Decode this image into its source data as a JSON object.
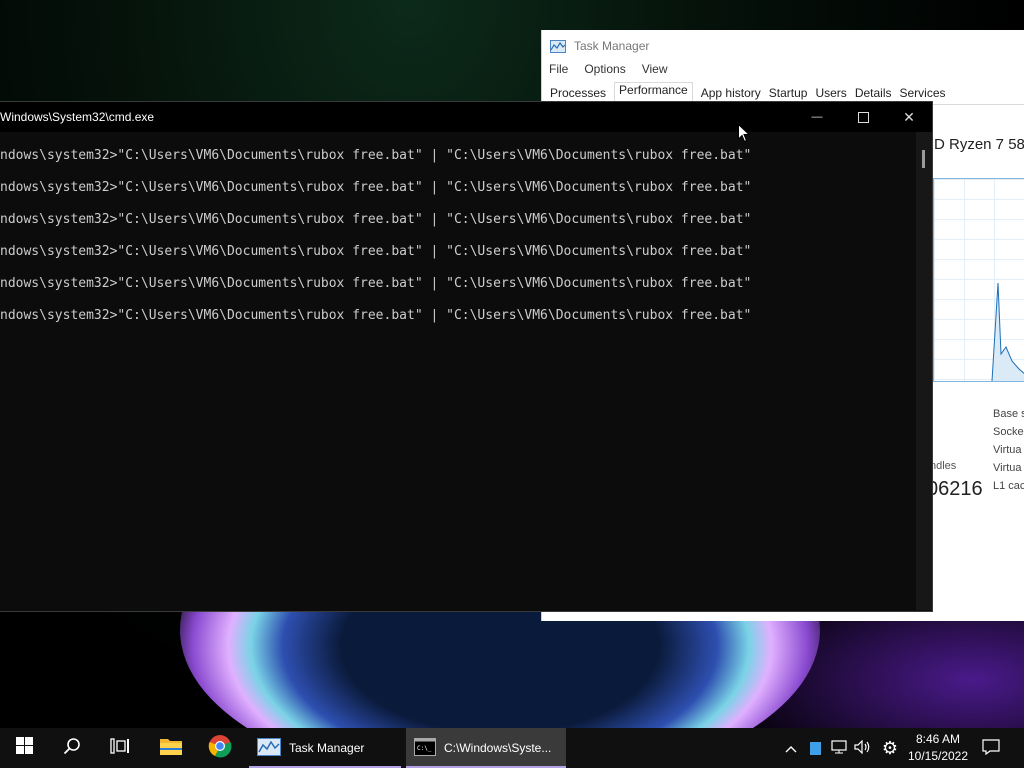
{
  "task_manager": {
    "title": "Task Manager",
    "menu": [
      "File",
      "Options",
      "View"
    ],
    "tabs": [
      "Processes",
      "Performance",
      "App history",
      "Startup",
      "Users",
      "Details",
      "Services"
    ],
    "active_tab": "Performance",
    "cpu_name_partial": "D Ryzen 7 58",
    "specs": [
      "Base s",
      "Socke",
      "Virtua",
      "Virtua",
      "L1 cac"
    ],
    "handles_label": "ndles",
    "handles_value": "06216"
  },
  "cmd": {
    "title": "Windows\\System32\\cmd.exe",
    "lines": [
      "ndows\\system32>\"C:\\Users\\VM6\\Documents\\rubox free.bat\" | \"C:\\Users\\VM6\\Documents\\rubox free.bat\"",
      "ndows\\system32>\"C:\\Users\\VM6\\Documents\\rubox free.bat\" | \"C:\\Users\\VM6\\Documents\\rubox free.bat\"",
      "ndows\\system32>\"C:\\Users\\VM6\\Documents\\rubox free.bat\" | \"C:\\Users\\VM6\\Documents\\rubox free.bat\"",
      "ndows\\system32>\"C:\\Users\\VM6\\Documents\\rubox free.bat\" | \"C:\\Users\\VM6\\Documents\\rubox free.bat\"",
      "ndows\\system32>\"C:\\Users\\VM6\\Documents\\rubox free.bat\" | \"C:\\Users\\VM6\\Documents\\rubox free.bat\"",
      "ndows\\system32>\"C:\\Users\\VM6\\Documents\\rubox free.bat\" | \"C:\\Users\\VM6\\Documents\\rubox free.bat\""
    ],
    "minimize_glyph": "—",
    "maximize_glyph": "☐",
    "close_glyph": "✕"
  },
  "taskbar": {
    "apps": [
      {
        "label": "Task Manager",
        "icon": "task-manager-icon"
      },
      {
        "label": "C:\\Windows\\Syste...",
        "icon": "cmd-icon"
      }
    ],
    "clock_time": "8:46 AM",
    "clock_date": "10/15/2022",
    "accent_color": "#b4a0e6"
  }
}
